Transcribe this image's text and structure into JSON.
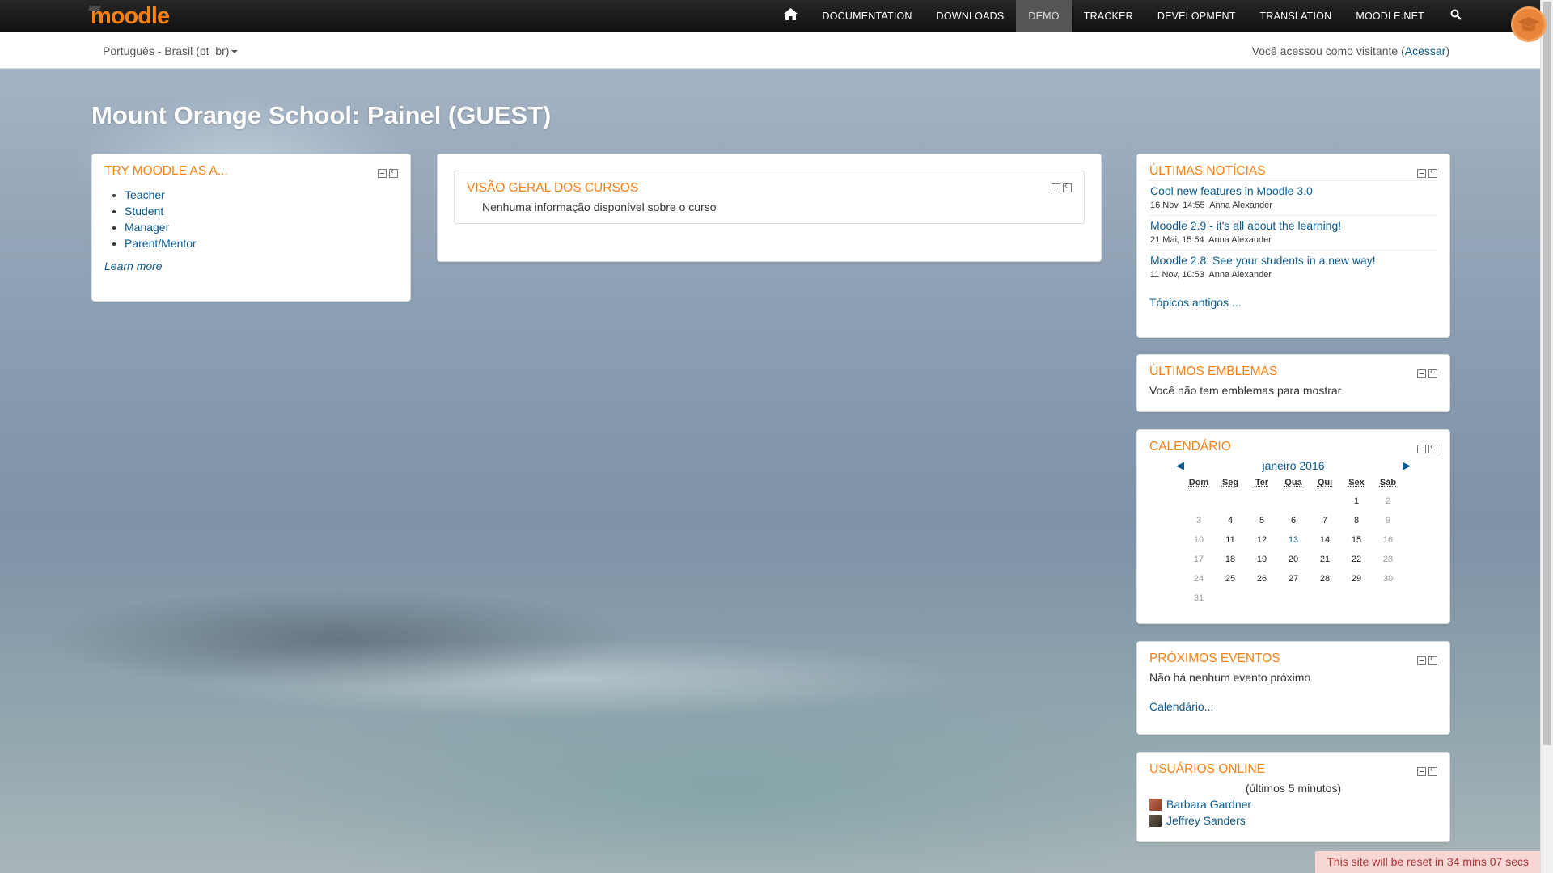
{
  "nav": {
    "logo": "moodle",
    "items": [
      {
        "label": "DOCUMENTATION",
        "active": false
      },
      {
        "label": "DOWNLOADS",
        "active": false
      },
      {
        "label": "DEMO",
        "active": true
      },
      {
        "label": "TRACKER",
        "active": false
      },
      {
        "label": "DEVELOPMENT",
        "active": false
      },
      {
        "label": "TRANSLATION",
        "active": false
      },
      {
        "label": "MOODLE.NET",
        "active": false
      }
    ]
  },
  "subbar": {
    "language": "Português - Brasil (pt_br)",
    "login_prefix": "Você acessou como visitante (",
    "login_link": "Acessar",
    "login_suffix": ")"
  },
  "page_title": "Mount Orange School: Painel (GUEST)",
  "try_moodle": {
    "title": "TRY MOODLE AS A...",
    "links": [
      "Teacher",
      "Student",
      "Manager",
      "Parent/Mentor"
    ],
    "learn_more": "Learn more"
  },
  "course_overview": {
    "title": "VISÃO GERAL DOS CURSOS",
    "message": "Nenhuma informação disponível sobre o curso"
  },
  "news": {
    "title": "ÚLTIMAS NOTÍCIAS",
    "items": [
      {
        "title": "Cool new features in Moodle 3.0",
        "date": "16 Nov, 14:55",
        "author": "Anna Alexander"
      },
      {
        "title": "Moodle 2.9 - it's all about the learning!",
        "date": "21 Mai, 15:54",
        "author": "Anna Alexander"
      },
      {
        "title": "Moodle 2.8: See your students in a new way!",
        "date": "11 Nov, 10:53",
        "author": "Anna Alexander"
      }
    ],
    "older": "Tópicos antigos ..."
  },
  "badges": {
    "title": "ÚLTIMOS EMBLEMAS",
    "message": "Você não tem emblemas para mostrar"
  },
  "calendar": {
    "title": "CALENDÁRIO",
    "month": "janeiro 2016",
    "days": [
      "Dom",
      "Seg",
      "Ter",
      "Qua",
      "Qui",
      "Sex",
      "Sáb"
    ],
    "weeks": [
      [
        "",
        "",
        "",
        "",
        "",
        "1",
        "2"
      ],
      [
        "3",
        "4",
        "5",
        "6",
        "7",
        "8",
        "9"
      ],
      [
        "10",
        "11",
        "12",
        "13",
        "14",
        "15",
        "16"
      ],
      [
        "17",
        "18",
        "19",
        "20",
        "21",
        "22",
        "23"
      ],
      [
        "24",
        "25",
        "26",
        "27",
        "28",
        "29",
        "30"
      ],
      [
        "31",
        "",
        "",
        "",
        "",
        "",
        ""
      ]
    ],
    "today": "13"
  },
  "events": {
    "title": "PRÓXIMOS EVENTOS",
    "message": "Não há nenhum evento próximo",
    "link": "Calendário..."
  },
  "online": {
    "title": "USUÁRIOS ONLINE",
    "subtitle": "(últimos 5 minutos)",
    "users": [
      "Barbara Gardner",
      "Jeffrey Sanders"
    ]
  },
  "reset_notice": "This site will be reset in 34 mins 07 secs",
  "colors": {
    "accent": "#f98012",
    "link": "#0b5a8f",
    "navbar": "#1a1a1a"
  }
}
